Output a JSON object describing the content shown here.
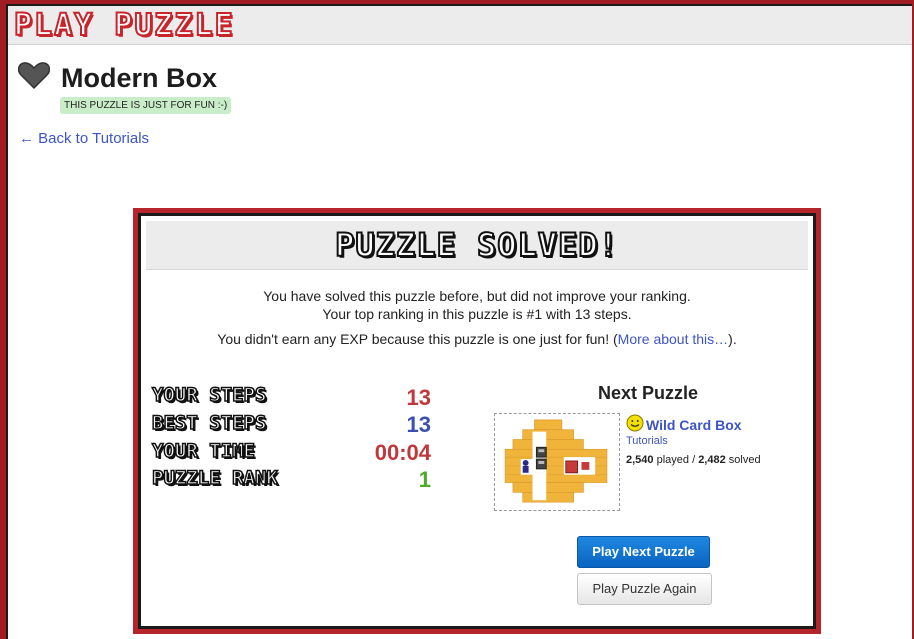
{
  "site": {
    "logo": "PLAY PUZZLE"
  },
  "puzzle": {
    "title": "Modern Box",
    "badge": "THIS PUZZLE IS JUST FOR FUN :-)",
    "back_link": "← Back to Tutorials"
  },
  "modal": {
    "heading": "PUZZLE SOLVED!",
    "message_line1": "You have solved this puzzle before, but did not improve your ranking.",
    "message_line2": "Your top ranking in this puzzle is #1 with 13 steps.",
    "message_line3_prefix": "You didn't earn any EXP because this puzzle is one just for fun! (",
    "message_line3_link": "More about this…",
    "message_line3_suffix": ").",
    "stats": [
      {
        "label": "YOUR STEPS",
        "value": "13",
        "color": "#c0383a"
      },
      {
        "label": "BEST STEPS",
        "value": "13",
        "color": "#3a4fb0"
      },
      {
        "label": "YOUR TIME",
        "value": "00:04",
        "color": "#c0383a"
      },
      {
        "label": "PUZZLE RANK",
        "value": "1",
        "color": "#4cab2a"
      }
    ],
    "next": {
      "heading": "Next Puzzle",
      "name": "Wild Card Box",
      "category": "Tutorials",
      "played": "2,540",
      "played_label": "played /",
      "solved": "2,482",
      "solved_label": "solved",
      "icon": "smiley-icon"
    },
    "buttons": {
      "play_next": "Play Next Puzzle",
      "play_again": "Play Puzzle Again"
    }
  },
  "colors": {
    "brand_red": "#b5252b",
    "link_blue": "#3d54c9",
    "badge_green": "#c9edc9",
    "primary_button": "#0a64c2"
  }
}
